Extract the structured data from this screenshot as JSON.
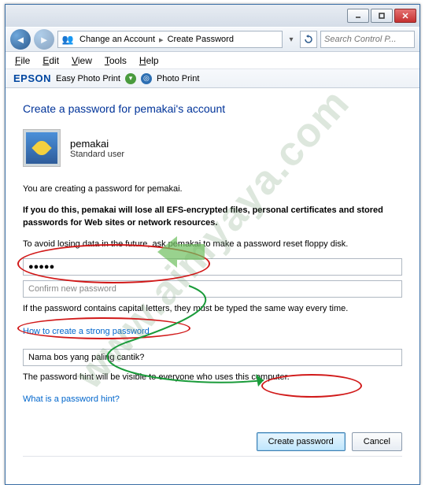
{
  "titlebar": {},
  "nav": {
    "crumb1": "Change an Account",
    "crumb2": "Create Password",
    "search_placeholder": "Search Control P..."
  },
  "menu": {
    "file": "File",
    "edit": "Edit",
    "view": "View",
    "tools": "Tools",
    "help": "Help"
  },
  "epson": {
    "logo": "EPSON",
    "easy": "Easy Photo Print",
    "photo": "Photo Print"
  },
  "main": {
    "heading": "Create a password for pemakai's account",
    "user_name": "pemakai",
    "user_type": "Standard user",
    "line1": "You are creating a password for pemakai.",
    "line2": "If you do this, pemakai will lose all EFS-encrypted files, personal certificates and stored passwords for Web sites or network resources.",
    "line3": "To avoid losing data in the future, ask pemakai to make a password reset floppy disk.",
    "pw_value": "●●●●●",
    "pw_confirm_placeholder": "Confirm new password",
    "caps_note": "If the password contains capital letters, they must be typed the same way every time.",
    "link_strong": "How to create a strong password",
    "hint_value": "Nama bos yang paling cantik?",
    "hint_note": "The password hint will be visible to everyone who uses this computer.",
    "link_hint": "What is a password hint?",
    "btn_create": "Create password",
    "btn_cancel": "Cancel"
  },
  "watermark": "www.aimyaya.com"
}
